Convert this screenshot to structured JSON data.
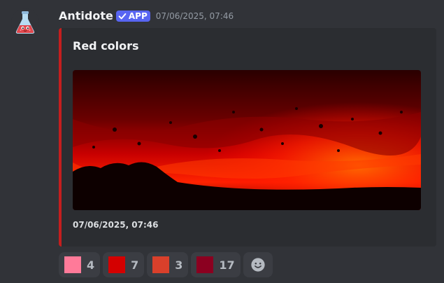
{
  "message": {
    "author": "Antidote",
    "badge": "APP",
    "timestamp": "07/06/2025, 07:46"
  },
  "embed": {
    "accent_color": "#c41e1e",
    "title": "Red colors",
    "footer": "07/06/2025, 07:46"
  },
  "reactions": [
    {
      "color": "#ff7a99",
      "count": "4"
    },
    {
      "color": "#d40000",
      "count": "7"
    },
    {
      "color": "#d9402b",
      "count": "3"
    },
    {
      "color": "#8b0020",
      "count": "17"
    }
  ],
  "add_reaction_icon": "smiley-icon"
}
